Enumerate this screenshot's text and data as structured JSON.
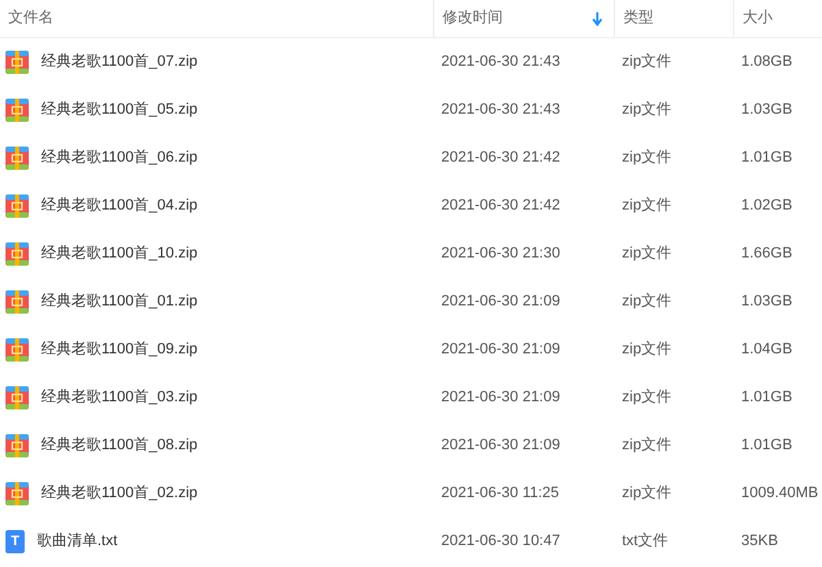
{
  "table": {
    "columns": [
      {
        "label": "文件名",
        "sorted": false
      },
      {
        "label": "修改时间",
        "sorted": true
      },
      {
        "label": "类型",
        "sorted": false
      },
      {
        "label": "大小",
        "sorted": false
      }
    ],
    "rows": [
      {
        "kind": "zip",
        "name": "经典老歌1100首_07.zip",
        "modified": "2021-06-30 21:43",
        "type": "zip文件",
        "size": "1.08GB"
      },
      {
        "kind": "zip",
        "name": "经典老歌1100首_05.zip",
        "modified": "2021-06-30 21:43",
        "type": "zip文件",
        "size": "1.03GB"
      },
      {
        "kind": "zip",
        "name": "经典老歌1100首_06.zip",
        "modified": "2021-06-30 21:42",
        "type": "zip文件",
        "size": "1.01GB"
      },
      {
        "kind": "zip",
        "name": "经典老歌1100首_04.zip",
        "modified": "2021-06-30 21:42",
        "type": "zip文件",
        "size": "1.02GB"
      },
      {
        "kind": "zip",
        "name": "经典老歌1100首_10.zip",
        "modified": "2021-06-30 21:30",
        "type": "zip文件",
        "size": "1.66GB"
      },
      {
        "kind": "zip",
        "name": "经典老歌1100首_01.zip",
        "modified": "2021-06-30 21:09",
        "type": "zip文件",
        "size": "1.03GB"
      },
      {
        "kind": "zip",
        "name": "经典老歌1100首_09.zip",
        "modified": "2021-06-30 21:09",
        "type": "zip文件",
        "size": "1.04GB"
      },
      {
        "kind": "zip",
        "name": "经典老歌1100首_03.zip",
        "modified": "2021-06-30 21:09",
        "type": "zip文件",
        "size": "1.01GB"
      },
      {
        "kind": "zip",
        "name": "经典老歌1100首_08.zip",
        "modified": "2021-06-30 21:09",
        "type": "zip文件",
        "size": "1.01GB"
      },
      {
        "kind": "zip",
        "name": "经典老歌1100首_02.zip",
        "modified": "2021-06-30 11:25",
        "type": "zip文件",
        "size": "1009.40MB"
      },
      {
        "kind": "txt",
        "icon_label": "T",
        "name": "歌曲清单.txt",
        "modified": "2021-06-30 10:47",
        "type": "txt文件",
        "size": "35KB"
      }
    ]
  }
}
